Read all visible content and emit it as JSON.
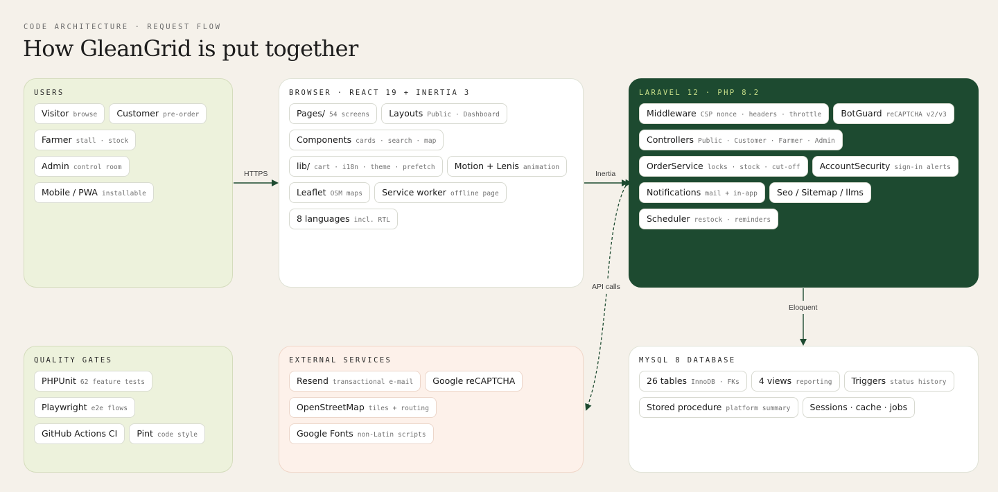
{
  "header": {
    "eyebrow": "CODE ARCHITECTURE · REQUEST FLOW",
    "title": "How GleanGrid is put together"
  },
  "panels": {
    "users": {
      "title": "USERS",
      "chips": [
        {
          "name": "Visitor",
          "note": "browse"
        },
        {
          "name": "Customer",
          "note": "pre-order"
        },
        {
          "name": "Farmer",
          "note": "stall · stock"
        },
        {
          "name": "Admin",
          "note": "control room"
        },
        {
          "name": "Mobile / PWA",
          "note": "installable"
        }
      ]
    },
    "browser": {
      "title": "BROWSER · REACT 19 + INERTIA 3",
      "chips": [
        {
          "name": "Pages/",
          "note": "54 screens"
        },
        {
          "name": "Layouts",
          "note": "Public · Dashboard"
        },
        {
          "name": "Components",
          "note": "cards · search · map"
        },
        {
          "name": "lib/",
          "note": "cart · i18n · theme · prefetch"
        },
        {
          "name": "Motion + Lenis",
          "note": "animation"
        },
        {
          "name": "Leaflet",
          "note": "OSM maps"
        },
        {
          "name": "Service worker",
          "note": "offline page"
        },
        {
          "name": "8 languages",
          "note": "incl. RTL"
        }
      ]
    },
    "laravel": {
      "title": "LARAVEL 12 · PHP 8.2",
      "chips": [
        {
          "name": "Middleware",
          "note": "CSP nonce · headers · throttle"
        },
        {
          "name": "BotGuard",
          "note": "reCAPTCHA v2/v3"
        },
        {
          "name": "Controllers",
          "note": "Public · Customer · Farmer · Admin"
        },
        {
          "name": "OrderService",
          "note": "locks · stock · cut-off"
        },
        {
          "name": "AccountSecurity",
          "note": "sign-in alerts"
        },
        {
          "name": "Notifications",
          "note": "mail + in-app"
        },
        {
          "name": "Seo / Sitemap / llms",
          "note": ""
        },
        {
          "name": "Scheduler",
          "note": "restock · reminders"
        }
      ]
    },
    "quality": {
      "title": "QUALITY GATES",
      "chips": [
        {
          "name": "PHPUnit",
          "note": "62 feature tests"
        },
        {
          "name": "Playwright",
          "note": "e2e flows"
        },
        {
          "name": "GitHub Actions CI",
          "note": ""
        },
        {
          "name": "Pint",
          "note": "code style"
        }
      ]
    },
    "external": {
      "title": "EXTERNAL SERVICES",
      "chips": [
        {
          "name": "Resend",
          "note": "transactional e-mail"
        },
        {
          "name": "Google reCAPTCHA",
          "note": ""
        },
        {
          "name": "OpenStreetMap",
          "note": "tiles + routing"
        },
        {
          "name": "Google Fonts",
          "note": "non-Latin scripts"
        }
      ]
    },
    "mysql": {
      "title": "MYSQL 8 DATABASE",
      "chips": [
        {
          "name": "26 tables",
          "note": "InnoDB · FKs"
        },
        {
          "name": "4 views",
          "note": "reporting"
        },
        {
          "name": "Triggers",
          "note": "status history"
        },
        {
          "name": "Stored procedure",
          "note": "platform summary"
        },
        {
          "name": "Sessions · cache · jobs",
          "note": ""
        }
      ]
    }
  },
  "connectors": {
    "https": "HTTPS",
    "inertia": "Inertia",
    "api_calls": "API calls",
    "eloquent": "Eloquent"
  },
  "colors": {
    "page_bg": "#f5f1ea",
    "green_panel": "#edf2dc",
    "dark_panel": "#1d4a30",
    "dark_panel_title": "#c9e08a",
    "peach_panel": "#fdf1ea",
    "arrow": "#1d4a30"
  }
}
